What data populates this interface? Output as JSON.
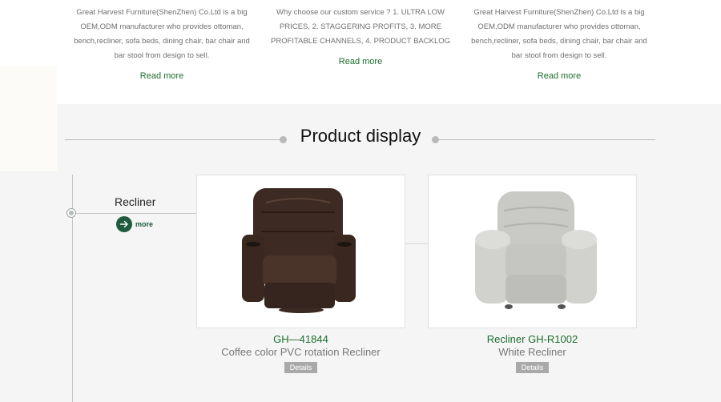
{
  "intro_columns": [
    {
      "text": "Great Harvest Furniture(ShenZhen) Co.Ltd is a big OEM,ODM manufacturer who provides ottoman, bench,recliner, sofa beds, dining chair, bar chair and bar stool from design to sell.",
      "read_more": "Read more"
    },
    {
      "text": "Why choose our custom service ? 1. ULTRA LOW PRICES, 2. STAGGERING PROFITS, 3. MORE PROFITABLE CHANNELS, 4. PRODUCT BACKLOG",
      "read_more": "Read more"
    },
    {
      "text": "Great Harvest Furniture(ShenZhen) Co.Ltd is a big OEM,ODM manufacturer who provides ottoman, bench,recliner, sofa beds, dining chair, bar chair and bar stool from design to sell.",
      "read_more": "Read more"
    }
  ],
  "section": {
    "title": "Product display"
  },
  "category": {
    "name": "Recliner",
    "more_label": "more",
    "icon": "arrow-right-icon"
  },
  "products": [
    {
      "code": "GH—41844",
      "name": "Coffee color PVC rotation Recliner",
      "details_label": "Details"
    },
    {
      "code": "Recliner GH-R1002",
      "name": "White Recliner",
      "details_label": "Details"
    }
  ],
  "colors": {
    "accent_green": "#1c6d2e",
    "more_button": "#1f5b3e",
    "details_button": "#a9a9a9"
  }
}
